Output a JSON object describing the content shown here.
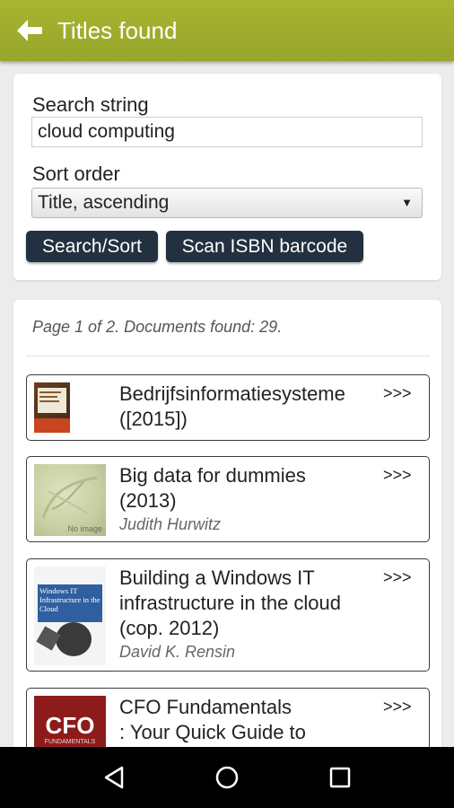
{
  "header": {
    "title": "Titles found"
  },
  "search": {
    "search_label": "Search string",
    "search_value": "cloud computing",
    "sort_label": "Sort order",
    "sort_value": "Title, ascending",
    "search_sort_button": "Search/Sort",
    "scan_button": "Scan ISBN barcode"
  },
  "results": {
    "page_info": "Page 1 of 2. Documents found: 29.",
    "more_label": ">>>",
    "items": [
      {
        "title": "Bedrijfsinformatiesysteme\n([2015])",
        "author": "",
        "thumb_icon": "book-cover-bedrijfsinformatiesystemen"
      },
      {
        "title": "Big data for dummies\n(2013)",
        "author": "Judith Hurwitz",
        "thumb_icon": "no-image-placeholder",
        "thumb_text": "No image"
      },
      {
        "title": "Building a Windows IT\ninfrastructure in the cloud\n(cop. 2012)",
        "author": "David K. Rensin",
        "thumb_icon": "book-cover-windows-it",
        "thumb_text": "Windows IT Infrastructure in the Cloud"
      },
      {
        "title": "CFO Fundamentals\n: Your Quick Guide to",
        "author": "",
        "thumb_icon": "book-cover-cfo",
        "thumb_text": "CFO",
        "thumb_subtext": "FUNDAMENTALS"
      }
    ]
  },
  "navbar": {
    "back_icon": "triangle-back-icon",
    "home_icon": "circle-home-icon",
    "recents_icon": "square-recents-icon"
  },
  "colors": {
    "appbar": "#9fac2e",
    "button": "#22303f",
    "background": "#ececec"
  }
}
